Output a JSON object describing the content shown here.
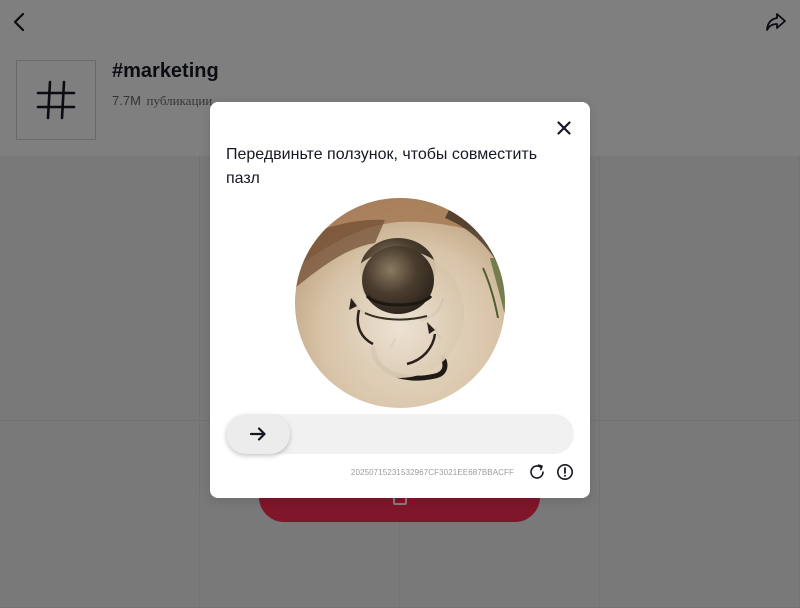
{
  "header": {
    "back_icon": "chevron-left-icon",
    "share_icon": "share-arrow-icon"
  },
  "hashtag": {
    "icon": "hashtag-icon",
    "title": "#marketing",
    "count": "7.7M",
    "count_label": "публикации"
  },
  "open_app_button": {
    "icon": "app-icon"
  },
  "captcha": {
    "close_icon": "close-icon",
    "instruction": "Передвиньте ползунок, чтобы совместить пазл",
    "slider_icon": "arrow-right-icon",
    "slider_position": 0,
    "request_id": "20250715231532967CF3021EE687BBACFF",
    "refresh_icon": "refresh-icon",
    "report_icon": "exclamation-circle-icon"
  },
  "colors": {
    "accent": "#fe2c55",
    "overlay": "rgba(0,0,0,0.5)",
    "text_primary": "#161823"
  }
}
